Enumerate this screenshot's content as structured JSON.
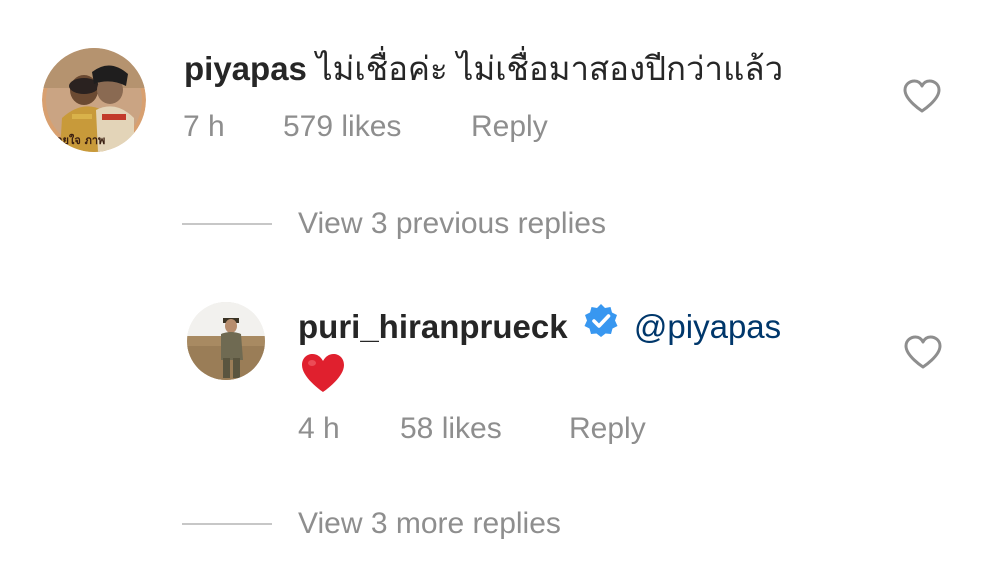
{
  "comment": {
    "username": "piyapas",
    "text": "ไม่เชื่อค่ะ ไม่เชื่อมาสองปีกว่าแล้ว",
    "time": "7 h",
    "likes": "579 likes",
    "reply_label": "Reply"
  },
  "view_previous": {
    "label": "View 3 previous replies"
  },
  "reply": {
    "username": "puri_hiranprueck",
    "verified": true,
    "mention": "@piyapas",
    "emoji": "heart",
    "time": "4 h",
    "likes": "58 likes",
    "reply_label": "Reply"
  },
  "view_more": {
    "label": "View 3 more replies"
  },
  "colors": {
    "text": "#262626",
    "meta": "#8e8e8e",
    "mention": "#00376b",
    "verified": "#3897f0",
    "heart": "#e0202e"
  }
}
